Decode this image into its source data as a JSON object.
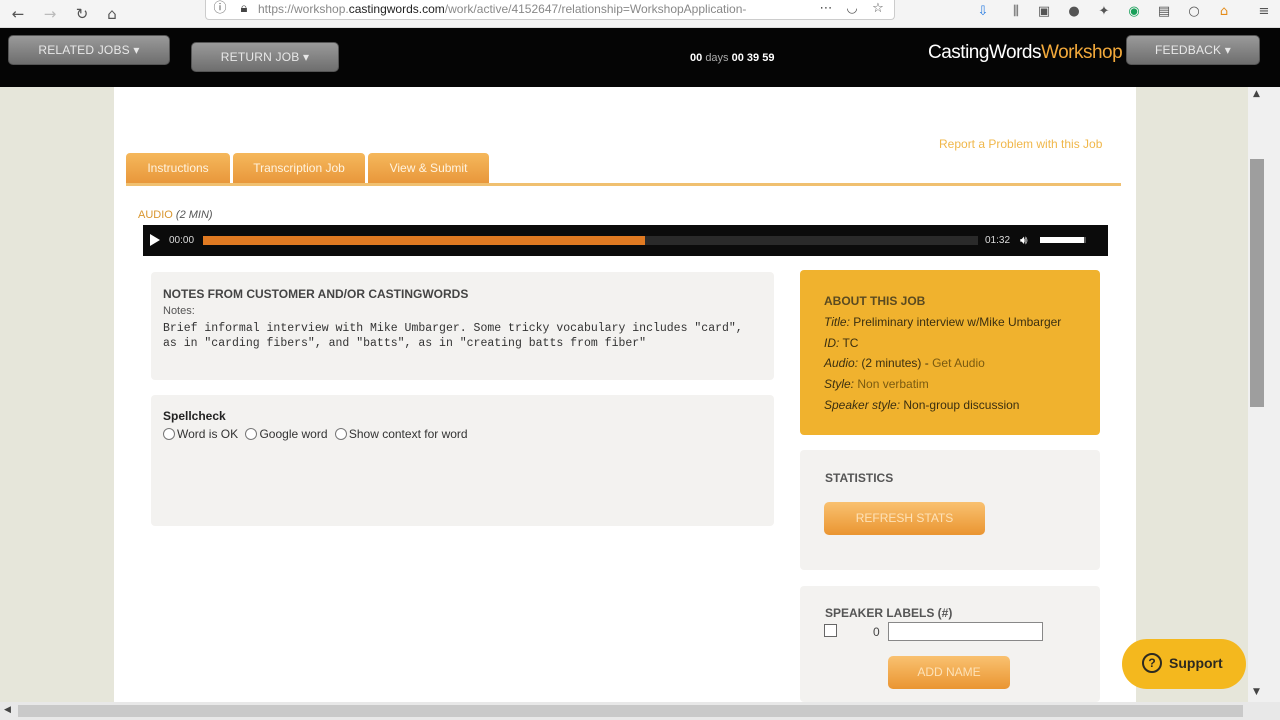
{
  "browser": {
    "url_prefix": "https://workshop.",
    "url_domain": "castingwords.com",
    "url_rest": "/work/active/4152647/relationship=WorkshopApplication-",
    "menu_icon": "≡"
  },
  "header": {
    "related_jobs": "RELATED JOBS ▾",
    "return_job": "RETURN JOB ▾",
    "timer_days": "00",
    "timer_days_label": "days",
    "timer_time": "00 39 59",
    "brand_main": "CastingWords",
    "brand_accent": "Workshop",
    "feedback": "FEEDBACK ▾"
  },
  "report_link": "Report a Problem with this Job",
  "tabs": [
    {
      "label": "Instructions"
    },
    {
      "label": "Transcription Job"
    },
    {
      "label": "View & Submit"
    }
  ],
  "audio": {
    "label": "AUDIO",
    "duration": "(2 MIN)",
    "current_time": "00:00",
    "end_time": "01:32",
    "progress_fraction": 0.57,
    "volume_fraction": 0.95
  },
  "notes": {
    "title": "NOTES FROM CUSTOMER AND/OR CASTINGWORDS",
    "sub": "Notes:",
    "body": "Brief informal interview with Mike Umbarger. Some tricky vocabulary includes \"card\", as in \"carding fibers\", and \"batts\", as in \"creating batts from fiber\""
  },
  "spellcheck": {
    "title": "Spellcheck",
    "options": [
      "Word is OK",
      "Google word",
      "Show context for word"
    ]
  },
  "about": {
    "title": "ABOUT THIS JOB",
    "title_label": "Title:",
    "title_value": "Preliminary interview w/Mike Umbarger",
    "id_label": "ID:",
    "id_value": "TC",
    "audio_label": "Audio:",
    "audio_value": "(2 minutes) -",
    "audio_link": "Get Audio",
    "style_label": "Style:",
    "style_value": "Non verbatim",
    "speaker_label": "Speaker style:",
    "speaker_value": "Non-group discussion"
  },
  "statistics": {
    "title": "STATISTICS",
    "refresh": "REFRESH STATS"
  },
  "speaker_labels": {
    "title": "SPEAKER LABELS (#)",
    "number": "0",
    "add_name": "ADD NAME"
  },
  "support": "Support",
  "colors": {
    "accent": "#f0b22e",
    "tab": "#e8963a",
    "progress": "#e07a22",
    "header": "#050505"
  }
}
